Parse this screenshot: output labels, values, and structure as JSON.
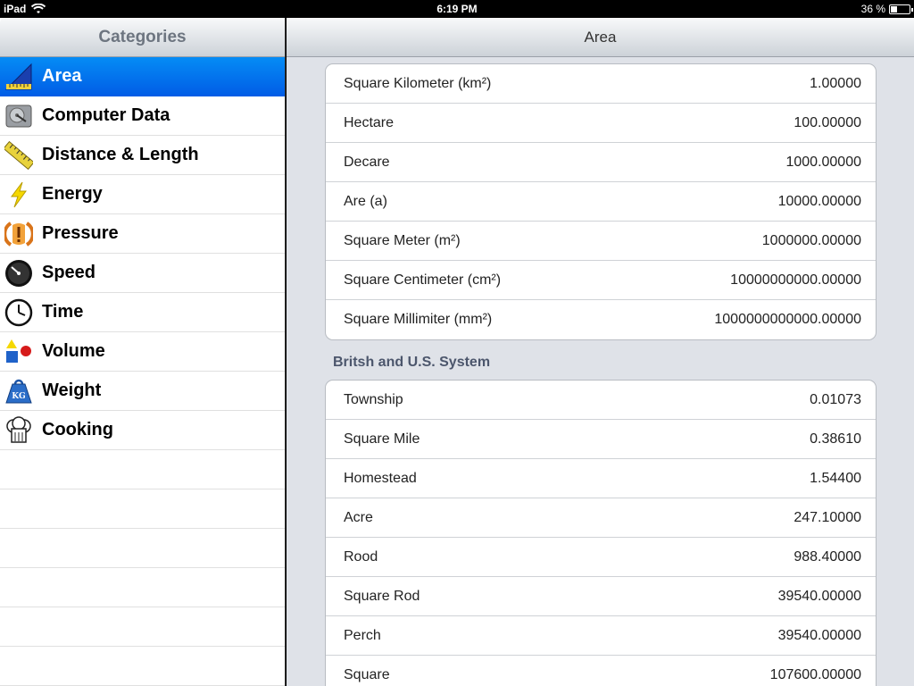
{
  "status": {
    "device": "iPad",
    "time": "6:19 PM",
    "battery": "36 %",
    "battery_level": 0.36
  },
  "sidebar": {
    "title": "Categories",
    "items": [
      {
        "label": "Area",
        "icon": "area-icon"
      },
      {
        "label": "Computer Data",
        "icon": "harddrive-icon"
      },
      {
        "label": "Distance & Length",
        "icon": "ruler-icon"
      },
      {
        "label": "Energy",
        "icon": "lightning-icon"
      },
      {
        "label": "Pressure",
        "icon": "pressure-warning-icon"
      },
      {
        "label": "Speed",
        "icon": "speedometer-icon"
      },
      {
        "label": "Time",
        "icon": "clock-icon"
      },
      {
        "label": "Volume",
        "icon": "shapes-icon"
      },
      {
        "label": "Weight",
        "icon": "kg-weight-icon"
      },
      {
        "label": "Cooking",
        "icon": "chef-hat-icon"
      }
    ],
    "selected_index": 0
  },
  "main": {
    "title": "Area",
    "metric_rows": [
      {
        "unit": "Square Kilometer (km²)",
        "value": "1.00000"
      },
      {
        "unit": "Hectare",
        "value": "100.00000"
      },
      {
        "unit": "Decare",
        "value": "1000.00000"
      },
      {
        "unit": "Are (a)",
        "value": "10000.00000"
      },
      {
        "unit": "Square Meter (m²)",
        "value": "1000000.00000"
      },
      {
        "unit": "Square Centimeter (cm²)",
        "value": "10000000000.00000"
      },
      {
        "unit": "Square Millimiter (mm²)",
        "value": "1000000000000.00000"
      }
    ],
    "section_header": "Britsh and U.S. System",
    "us_rows": [
      {
        "unit": "Township",
        "value": "0.01073"
      },
      {
        "unit": "Square Mile",
        "value": "0.38610"
      },
      {
        "unit": "Homestead",
        "value": "1.54400"
      },
      {
        "unit": "Acre",
        "value": "247.10000"
      },
      {
        "unit": "Rood",
        "value": "988.40000"
      },
      {
        "unit": "Square Rod",
        "value": "39540.00000"
      },
      {
        "unit": "Perch",
        "value": "39540.00000"
      },
      {
        "unit": "Square",
        "value": "107600.00000"
      }
    ]
  }
}
